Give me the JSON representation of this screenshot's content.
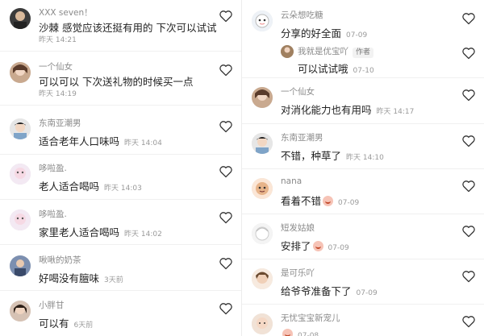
{
  "left_comments": [
    {
      "name": "XXX seven！",
      "text": "沙棘 感觉应该还挺有用的 下次可以试试",
      "time": "昨天 14:21",
      "time_inline": false
    },
    {
      "name": "一个仙女",
      "text": "可以可以 下次送礼物的时候买一点",
      "time": "昨天 14:19",
      "time_inline": false
    },
    {
      "name": "东南亚潮男",
      "text": "适合老年人口味吗",
      "time": "昨天 14:04",
      "time_inline": true
    },
    {
      "name": "哆啦盈.",
      "text": "老人适合喝吗",
      "time": "昨天 14:03",
      "time_inline": true
    },
    {
      "name": "哆啦盈.",
      "text": "家里老人适合喝吗",
      "time": "昨天 14:02",
      "time_inline": true
    },
    {
      "name": "啾啾的奶茶",
      "text": "好喝没有膻味",
      "time": "3天前",
      "time_inline": true
    },
    {
      "name": "小胖甘",
      "text": "可以有",
      "time": "6天前",
      "time_inline": true
    }
  ],
  "right_comments": [
    {
      "name": "云朵想吃糖",
      "text": "分享的好全面",
      "time": "07-09"
    },
    {
      "name": "我就是优宝吖",
      "badge": "作者",
      "text": "可以试试哦",
      "time": "07-10"
    },
    {
      "name": "一个仙女",
      "text": "对消化能力也有用吗",
      "time": "昨天 14:17"
    },
    {
      "name": "东南亚潮男",
      "text": "不错，种草了",
      "time": "昨天 14:10"
    },
    {
      "name": "nana",
      "text": "看着不错",
      "time": "07-09"
    },
    {
      "name": "短发姑娘",
      "text": "安排了",
      "time": "07-09"
    },
    {
      "name": "是可乐吖",
      "text": "给爷爷准备下了",
      "time": "07-09"
    },
    {
      "name": "无忧宝宝新宠儿",
      "text": "",
      "time": "07-08"
    }
  ],
  "icons": {
    "like": "heart-outline-icon",
    "emoji": "blush-emoji-icon"
  },
  "colors": {
    "name": "#8a8a8a",
    "time": "#9a9a9a",
    "text": "#222222"
  }
}
